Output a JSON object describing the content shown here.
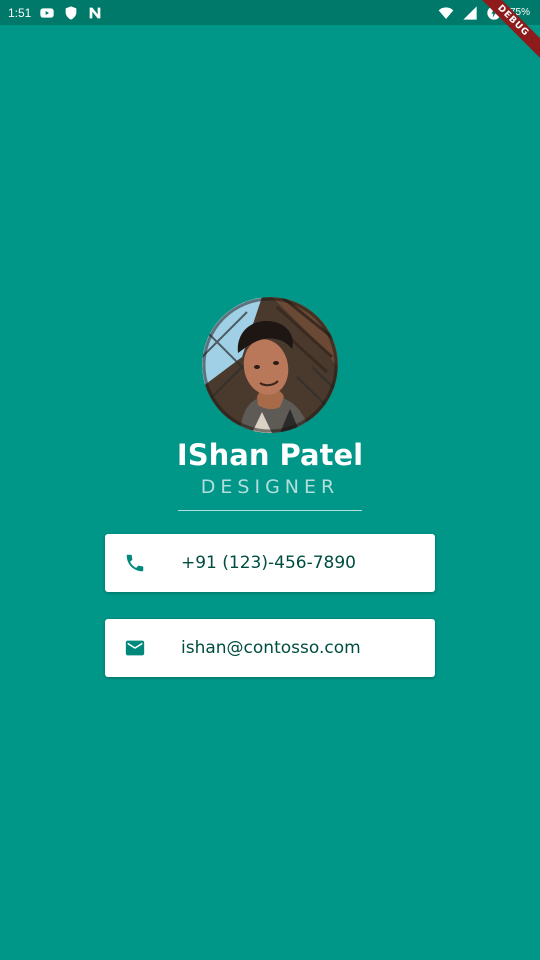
{
  "status_bar": {
    "time": "1:51",
    "battery_percent": "75%",
    "left_icons": [
      "youtube-icon",
      "shield-icon",
      "n-notification-icon"
    ],
    "right_icons": [
      "wifi-icon",
      "cell-signal-icon",
      "battery-charging-icon"
    ]
  },
  "debug_banner": "DEBUG",
  "profile": {
    "name": "IShan Patel",
    "title": "DESIGNER"
  },
  "contacts": {
    "phone": {
      "icon": "phone-icon",
      "value": "+91 (123)-456-7890"
    },
    "email": {
      "icon": "mail-icon",
      "value": "ishan@contosso.com"
    }
  },
  "colors": {
    "background": "#009688",
    "status_bar": "#00796b",
    "card": "#ffffff",
    "accent": "#00897b",
    "card_text": "#004d40",
    "subtitle": "#b2dfdb"
  }
}
